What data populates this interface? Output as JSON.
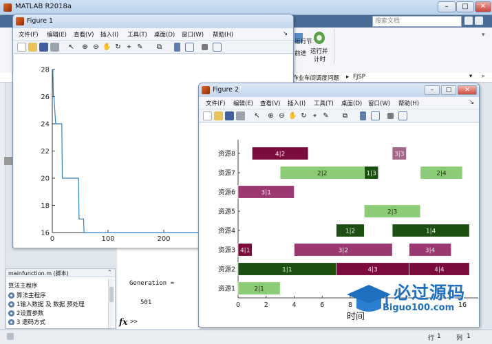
{
  "matlab": {
    "title": "MATLAB R2018a",
    "search_placeholder": "搜索文档",
    "ribbon": {
      "run_section_label": "运行节",
      "advance_label": "前进",
      "run_timed_label": "运行并\n计时",
      "run_timed_line1": "运行并",
      "run_timed_line2": "计时"
    },
    "path": {
      "segment": "作业车间调度问题",
      "current": "FJSP"
    },
    "file_panel": {
      "header": "mainfunction.m  (脚本)",
      "items": [
        "算法主程序",
        "算法主程序",
        "1输入数据 及  数据 预处理",
        "2设置参数",
        "3 遗码方式"
      ]
    },
    "command": {
      "line1": "Generation =",
      "line2": "501",
      "prompt": ">>"
    },
    "status": {
      "row_label": "行",
      "row_value": "1",
      "col_label": "列",
      "col_value": "1"
    }
  },
  "figure1": {
    "title": "Figure 1",
    "menu": [
      "文件(F)",
      "编辑(E)",
      "查看(V)",
      "插入(I)",
      "工具(T)",
      "桌面(D)",
      "窗口(W)",
      "帮助(H)"
    ]
  },
  "figure2": {
    "title": "Figure 2",
    "menu": [
      "文件(F)",
      "编辑(E)",
      "查看(V)",
      "插入(I)",
      "工具(T)",
      "桌面(D)",
      "窗口(W)",
      "帮助(H)"
    ]
  },
  "watermark": {
    "cn": "必过源码",
    "url": "Biguo100.com"
  },
  "colors": {
    "dark_green": "#1b5011",
    "light_green": "#8ccc76",
    "maroon": "#7a0b3c",
    "mauve": "#9c3870",
    "light_mauve": "#a5648a",
    "line_blue": "#2c7fc4"
  },
  "chart_data": [
    {
      "type": "line",
      "title": "",
      "xlabel": "",
      "ylabel": "",
      "xlim": [
        0,
        400
      ],
      "ylim": [
        16,
        28
      ],
      "xticks": [
        0,
        100,
        200,
        300,
        400
      ],
      "yticks": [
        16,
        18,
        20,
        22,
        24,
        26,
        28
      ],
      "series": [
        {
          "x": [
            0,
            1,
            2,
            3,
            6,
            8,
            9,
            17,
            18,
            47,
            48,
            56,
            57,
            430
          ],
          "y": [
            28,
            28,
            26,
            26,
            24,
            24,
            24,
            24,
            20,
            20,
            17,
            17,
            16,
            16
          ]
        }
      ]
    },
    {
      "type": "gantt",
      "title": "",
      "xlabel": "时间",
      "ylabel": "",
      "xlim": [
        0,
        16
      ],
      "xticks": [
        0,
        2,
        4,
        6,
        8,
        10,
        12,
        14,
        16
      ],
      "xtick_labels": [
        "0",
        "2",
        "4",
        "6",
        "8",
        "",
        "",
        "",
        "16"
      ],
      "categories": [
        "资源1",
        "资源2",
        "资源3",
        "资源4",
        "资源5",
        "资源6",
        "资源7",
        "资源8"
      ],
      "bars": [
        {
          "resource": 1,
          "start": 0,
          "end": 3,
          "label": "2|1",
          "color": "light_green"
        },
        {
          "resource": 2,
          "start": 0,
          "end": 7,
          "label": "1|1",
          "color": "dark_green"
        },
        {
          "resource": 2,
          "start": 7,
          "end": 12.2,
          "label": "4|3",
          "color": "maroon"
        },
        {
          "resource": 2,
          "start": 12.2,
          "end": 16.5,
          "label": "4|4",
          "color": "maroon"
        },
        {
          "resource": 3,
          "start": 0,
          "end": 1,
          "label": "4|1",
          "color": "maroon"
        },
        {
          "resource": 3,
          "start": 4,
          "end": 11,
          "label": "3|2",
          "color": "mauve"
        },
        {
          "resource": 3,
          "start": 12.2,
          "end": 15.2,
          "label": "3|4",
          "color": "mauve"
        },
        {
          "resource": 4,
          "start": 7,
          "end": 9,
          "label": "1|2",
          "color": "dark_green"
        },
        {
          "resource": 4,
          "start": 11,
          "end": 16.5,
          "label": "1|4",
          "color": "dark_green"
        },
        {
          "resource": 5,
          "start": 9,
          "end": 13,
          "label": "2|3",
          "color": "light_green"
        },
        {
          "resource": 6,
          "start": 0,
          "end": 4,
          "label": "3|1",
          "color": "mauve"
        },
        {
          "resource": 7,
          "start": 3,
          "end": 9,
          "label": "2|2",
          "color": "light_green"
        },
        {
          "resource": 7,
          "start": 9,
          "end": 10,
          "label": "1|3",
          "color": "dark_green"
        },
        {
          "resource": 7,
          "start": 13,
          "end": 16,
          "label": "2|4",
          "color": "light_green"
        },
        {
          "resource": 8,
          "start": 1,
          "end": 5,
          "label": "4|2",
          "color": "maroon"
        },
        {
          "resource": 8,
          "start": 11,
          "end": 12,
          "label": "3|3",
          "color": "light_mauve"
        }
      ]
    }
  ]
}
